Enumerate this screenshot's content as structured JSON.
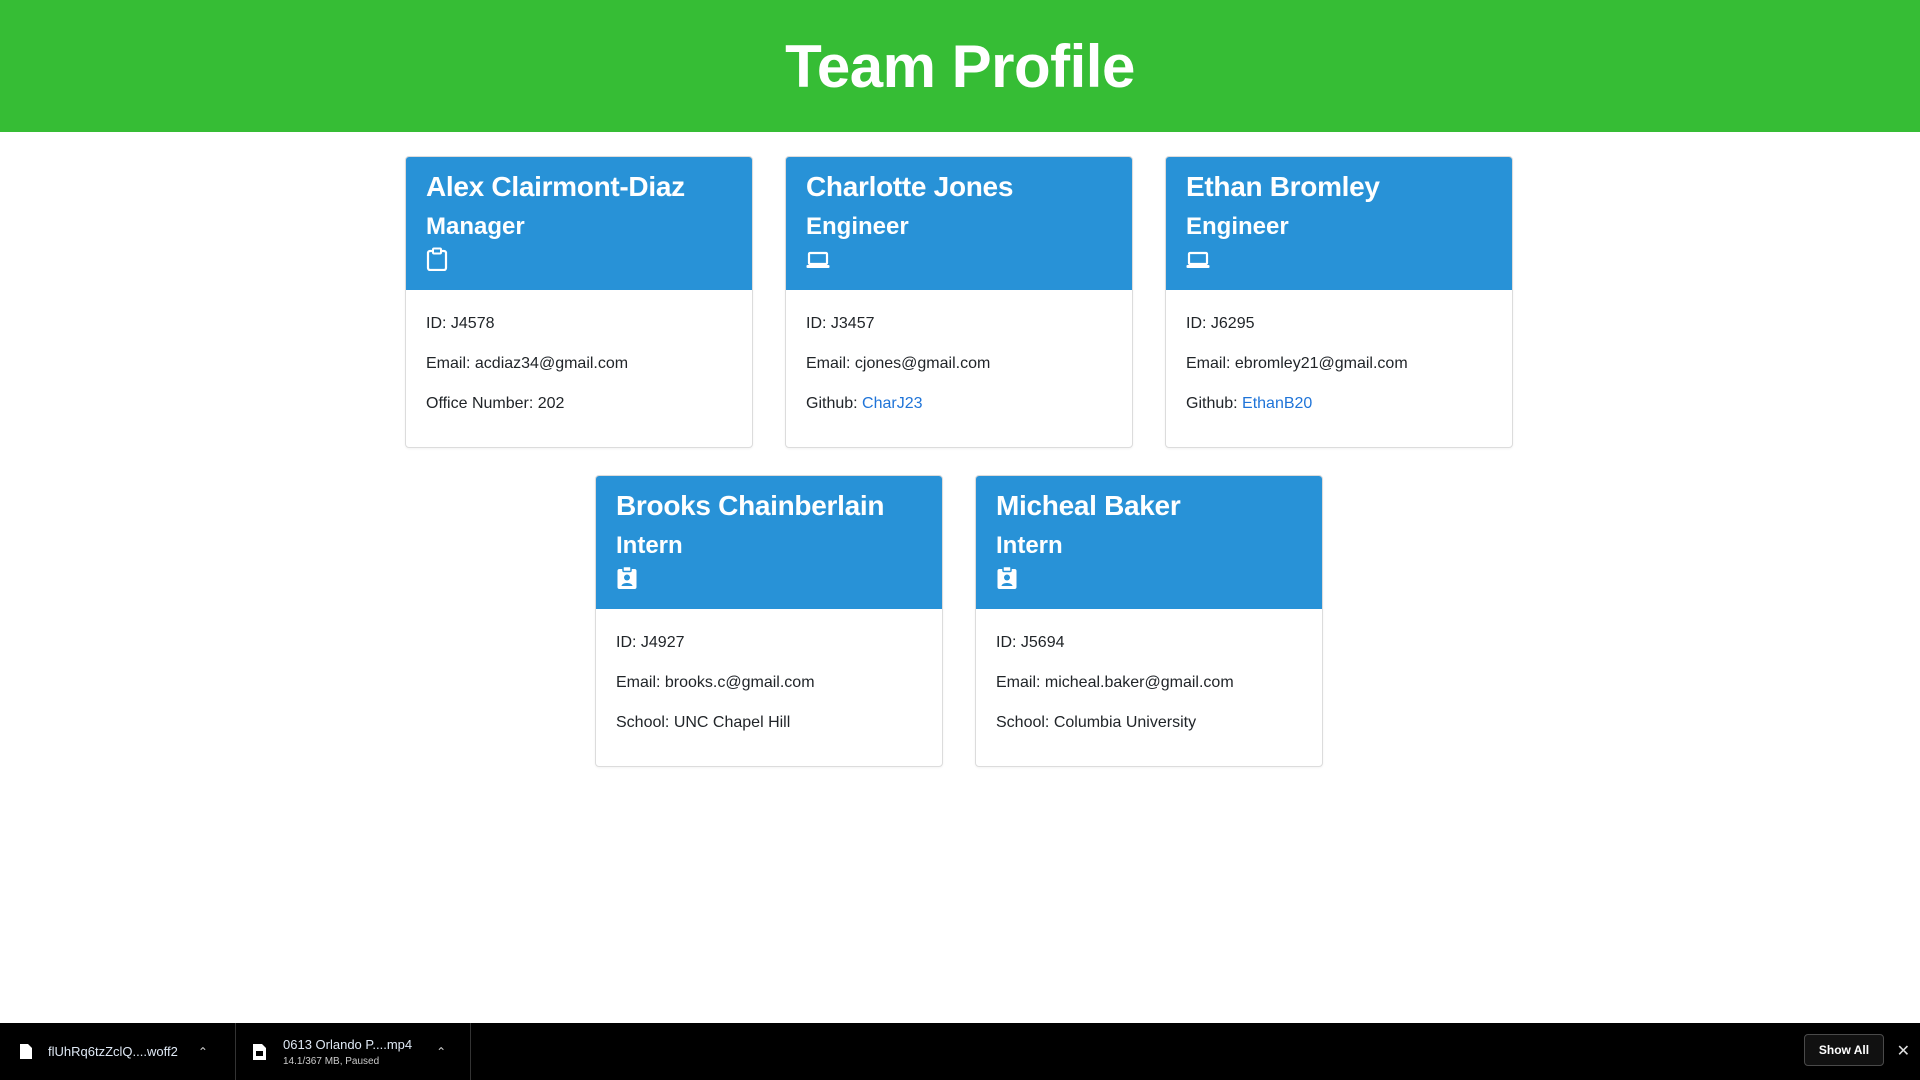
{
  "header": {
    "title": "Team Profile"
  },
  "colors": {
    "header_bg": "#36bd35",
    "card_head_bg": "#2892d7",
    "link": "#1f74d8"
  },
  "cards": [
    {
      "name": "Alex Clairmont-Diaz",
      "role": "Manager",
      "icon": "clipboard-icon",
      "id_text": "ID: J4578",
      "email_text": "Email: acdiaz34@gmail.com",
      "extra_text": "Office Number: 202"
    },
    {
      "name": "Charlotte Jones",
      "role": "Engineer",
      "icon": "laptop-icon",
      "id_text": "ID: J3457",
      "email_text": "Email: cjones@gmail.com",
      "extra_label": "Github: ",
      "extra_link": "CharJ23"
    },
    {
      "name": "Ethan Bromley",
      "role": "Engineer",
      "icon": "laptop-icon",
      "id_text": "ID: J6295",
      "email_text": "Email: ebromley21@gmail.com",
      "extra_label": "Github: ",
      "extra_link": "EthanB20"
    },
    {
      "name": "Brooks Chainberlain",
      "role": "Intern",
      "icon": "user-badge-icon",
      "id_text": "ID: J4927",
      "email_text": "Email: brooks.c@gmail.com",
      "extra_text": "School: UNC Chapel Hill"
    },
    {
      "name": "Micheal Baker",
      "role": "Intern",
      "icon": "user-badge-icon",
      "id_text": "ID: J5694",
      "email_text": "Email: micheal.baker@gmail.com",
      "extra_text": "School: Columbia University"
    }
  ],
  "downloads": {
    "items": [
      {
        "name": "flUhRq6tzZclQ....woff2",
        "icon": "file-icon"
      },
      {
        "name": "0613 Orlando P....mp4",
        "status": "14.1/367 MB, Paused",
        "icon": "video-file-icon"
      }
    ],
    "show_all_label": "Show All",
    "close_icon": "close-icon"
  }
}
